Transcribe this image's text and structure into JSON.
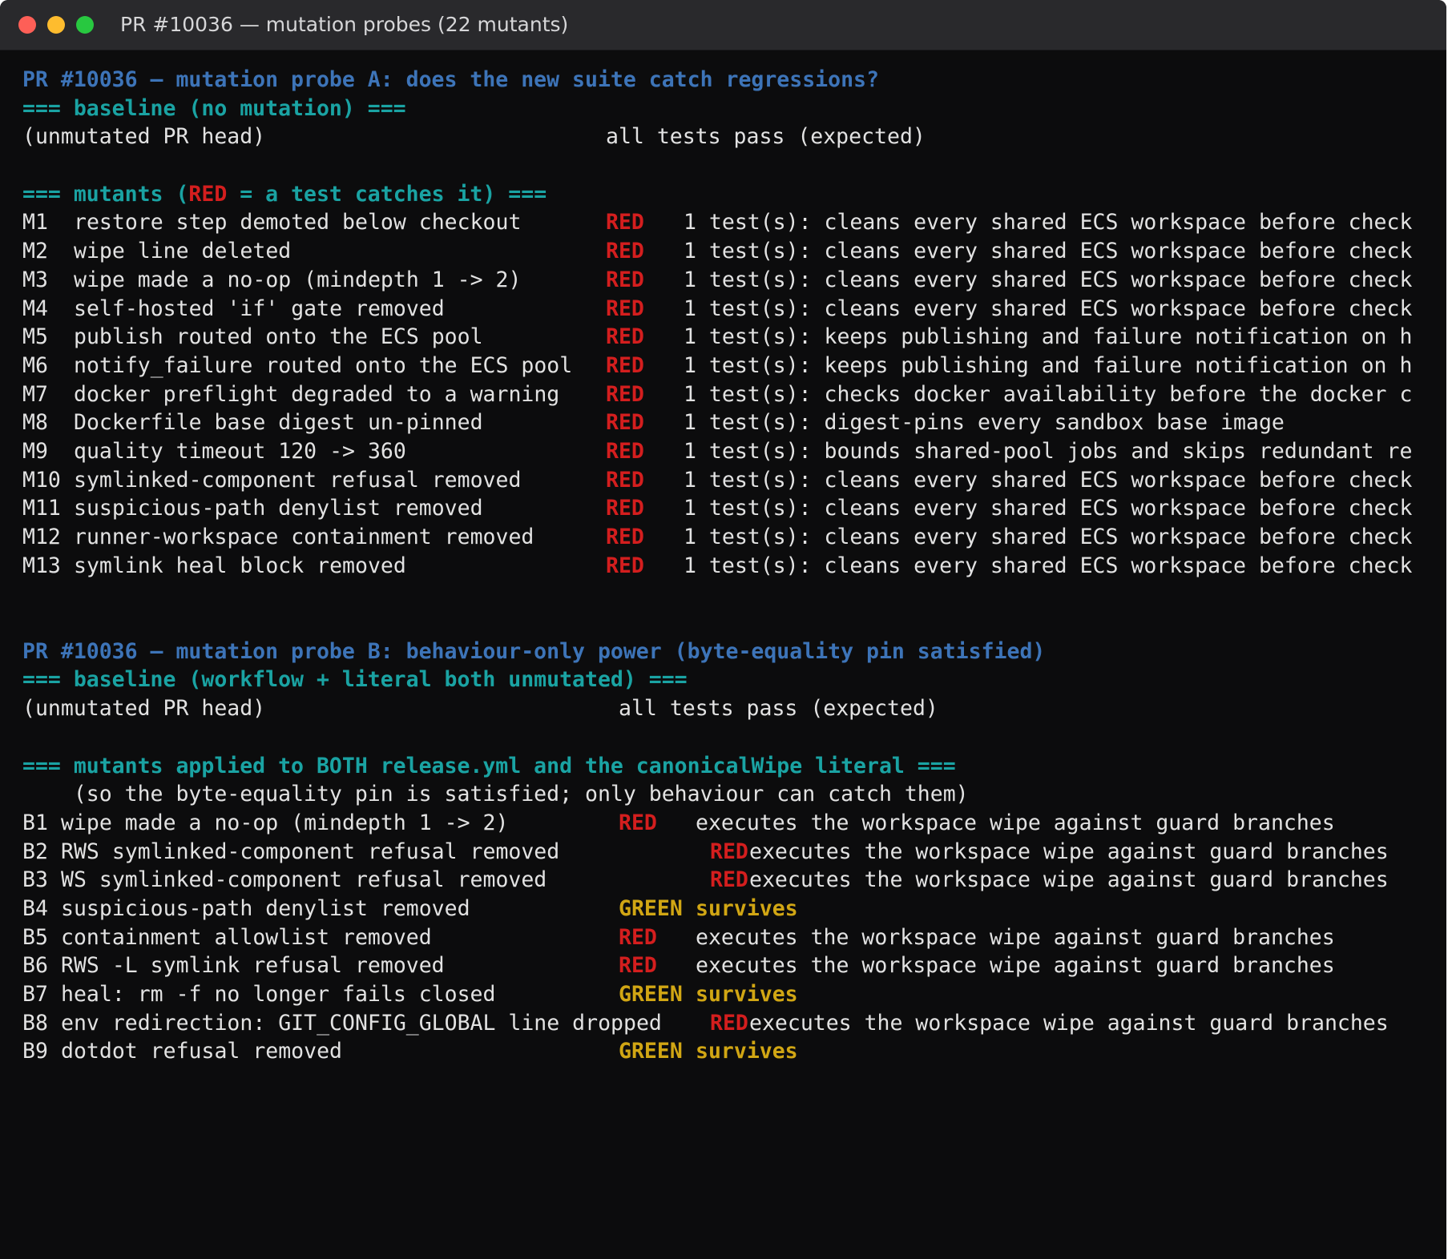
{
  "window": {
    "title": "PR #10036 — mutation probes (22 mutants)"
  },
  "colors": {
    "heading_blue": "#3d74b8",
    "heading_cyan": "#1aa3a3",
    "status_red": "#d41e1e",
    "status_green_yellow": "#d1a614",
    "text": "#e2e2e2",
    "background": "#0c0c0d"
  },
  "probeA": {
    "title": "PR #10036 — mutation probe A: does the new suite catch regressions?",
    "baseline_header": "=== baseline (no mutation) ===",
    "baseline_label": "(unmutated PR head)",
    "baseline_result": "all tests pass (expected)",
    "mutants_header_prefix": "=== mutants (",
    "mutants_header_red": "RED",
    "mutants_header_suffix": " = a test catches it) ===",
    "mutants": [
      {
        "id": "M1",
        "desc": "restore step demoted below checkout",
        "status": "RED",
        "detail": "1 test(s): cleans every shared ECS workspace before check"
      },
      {
        "id": "M2",
        "desc": "wipe line deleted",
        "status": "RED",
        "detail": "1 test(s): cleans every shared ECS workspace before check"
      },
      {
        "id": "M3",
        "desc": "wipe made a no-op (mindepth 1 -> 2)",
        "status": "RED",
        "detail": "1 test(s): cleans every shared ECS workspace before check"
      },
      {
        "id": "M4",
        "desc": "self-hosted 'if' gate removed",
        "status": "RED",
        "detail": "1 test(s): cleans every shared ECS workspace before check"
      },
      {
        "id": "M5",
        "desc": "publish routed onto the ECS pool",
        "status": "RED",
        "detail": "1 test(s): keeps publishing and failure notification on h"
      },
      {
        "id": "M6",
        "desc": "notify_failure routed onto the ECS pool",
        "status": "RED",
        "detail": "1 test(s): keeps publishing and failure notification on h"
      },
      {
        "id": "M7",
        "desc": "docker preflight degraded to a warning",
        "status": "RED",
        "detail": "1 test(s): checks docker availability before the docker c"
      },
      {
        "id": "M8",
        "desc": "Dockerfile base digest un-pinned",
        "status": "RED",
        "detail": "1 test(s): digest-pins every sandbox base image"
      },
      {
        "id": "M9",
        "desc": "quality timeout 120 -> 360",
        "status": "RED",
        "detail": "1 test(s): bounds shared-pool jobs and skips redundant re"
      },
      {
        "id": "M10",
        "desc": "symlinked-component refusal removed",
        "status": "RED",
        "detail": "1 test(s): cleans every shared ECS workspace before check"
      },
      {
        "id": "M11",
        "desc": "suspicious-path denylist removed",
        "status": "RED",
        "detail": "1 test(s): cleans every shared ECS workspace before check"
      },
      {
        "id": "M12",
        "desc": "runner-workspace containment removed",
        "status": "RED",
        "detail": "1 test(s): cleans every shared ECS workspace before check"
      },
      {
        "id": "M13",
        "desc": "symlink heal block removed",
        "status": "RED",
        "detail": "1 test(s): cleans every shared ECS workspace before check"
      }
    ]
  },
  "probeB": {
    "title": "PR #10036 — mutation probe B: behaviour-only power (byte-equality pin satisfied)",
    "baseline_header": "=== baseline (workflow + literal both unmutated) ===",
    "baseline_label": "(unmutated PR head)",
    "baseline_result": "all tests pass (expected)",
    "mutants_header": "=== mutants applied to BOTH release.yml and the canonicalWipe literal ===",
    "mutants_note": "    (so the byte-equality pin is satisfied; only behaviour can catch them)",
    "mutants": [
      {
        "id": "B1",
        "desc": "wipe made a no-op (mindepth 1 -> 2)",
        "status": "RED",
        "detail": "executes the workspace wipe against guard branches"
      },
      {
        "id": "B2",
        "desc": "RWS symlinked-component refusal removed",
        "status": "RED",
        "detail": "executes the workspace wipe against guard branches"
      },
      {
        "id": "B3",
        "desc": "WS symlinked-component refusal removed",
        "status": "RED",
        "detail": "executes the workspace wipe against guard branches"
      },
      {
        "id": "B4",
        "desc": "suspicious-path denylist removed",
        "status": "GREEN",
        "detail": "survives"
      },
      {
        "id": "B5",
        "desc": "containment allowlist removed",
        "status": "RED",
        "detail": "executes the workspace wipe against guard branches"
      },
      {
        "id": "B6",
        "desc": "RWS -L symlink refusal removed",
        "status": "RED",
        "detail": "executes the workspace wipe against guard branches"
      },
      {
        "id": "B7",
        "desc": "heal: rm -f no longer fails closed",
        "status": "GREEN",
        "detail": "survives"
      },
      {
        "id": "B8",
        "desc": "env redirection: GIT_CONFIG_GLOBAL line dropped",
        "status": "RED",
        "detail": "executes the workspace wipe against guard branches"
      },
      {
        "id": "B9",
        "desc": "dotdot refusal removed",
        "status": "GREEN",
        "detail": "survives"
      }
    ]
  }
}
